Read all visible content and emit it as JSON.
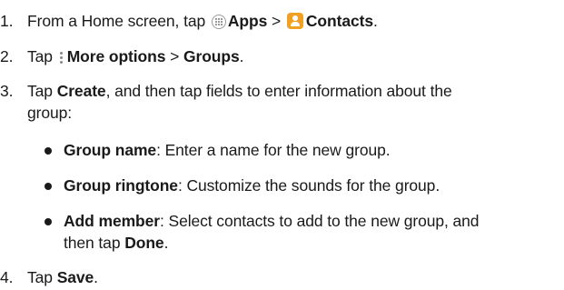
{
  "steps": [
    {
      "number": "1.",
      "t1": "From a Home screen, tap",
      "b1": "Apps",
      "sep": ">",
      "b2": "Contacts",
      "t2": ".",
      "icons": [
        "apps-icon",
        "contacts-icon"
      ]
    },
    {
      "number": "2.",
      "t1": "Tap",
      "b1": "More options",
      "sep": ">",
      "b2": "Groups",
      "t2": ".",
      "icons": [
        "more-options-icon"
      ]
    },
    {
      "number": "3.",
      "t1": "Tap",
      "b1": "Create",
      "t2": ", and then tap fields to enter information about the",
      "t3": "group:",
      "sub_items": [
        {
          "bold": "Group name",
          "text": ": Enter a name for the new group."
        },
        {
          "bold": "Group ringtone",
          "text": ": Customize the sounds for the group."
        },
        {
          "bold": "Add member",
          "text": ": Select contacts to add to the new group, and",
          "text2a": "then tap",
          "bold2": "Done",
          "text2b": "."
        }
      ]
    },
    {
      "number": "4.",
      "t1": "Tap",
      "b1": "Save",
      "t2": "."
    }
  ],
  "colors": {
    "text": "#1a1a1a",
    "contacts_icon": "#f0a023"
  }
}
